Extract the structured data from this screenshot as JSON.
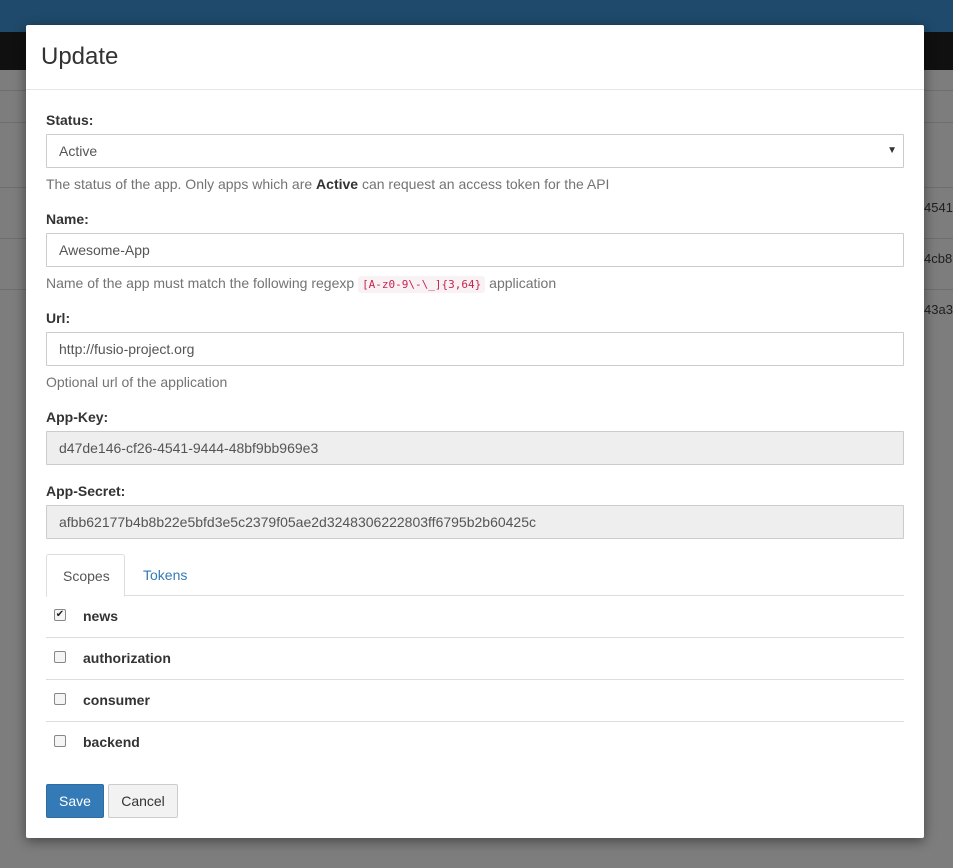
{
  "background": {
    "cells": [
      "4541-",
      "4cb8",
      "43a3"
    ]
  },
  "modal": {
    "title": "Update",
    "status": {
      "label": "Status:",
      "value": "Active",
      "help_prefix": "The status of the app. Only apps which are ",
      "help_bold": "Active",
      "help_suffix": " can request an access token for the API"
    },
    "name": {
      "label": "Name:",
      "value": "Awesome-App",
      "help_prefix": "Name of the app must match the following regexp ",
      "help_code": "[A-z0-9\\-\\_]{3,64}",
      "help_suffix": " application"
    },
    "url": {
      "label": "Url:",
      "value": "http://fusio-project.org",
      "help": "Optional url of the application"
    },
    "app_key": {
      "label": "App-Key:",
      "value": "d47de146-cf26-4541-9444-48bf9bb969e3"
    },
    "app_secret": {
      "label": "App-Secret:",
      "value": "afbb62177b4b8b22e5bfd3e5c2379f05ae2d3248306222803ff6795b2b60425c"
    },
    "tabs": [
      "Scopes",
      "Tokens"
    ],
    "scopes": [
      {
        "name": "news",
        "checked": true
      },
      {
        "name": "authorization",
        "checked": false
      },
      {
        "name": "consumer",
        "checked": false
      },
      {
        "name": "backend",
        "checked": false
      }
    ],
    "buttons": {
      "save": "Save",
      "cancel": "Cancel"
    }
  },
  "colors": {
    "primary": "#337ab7",
    "link": "#337ab7",
    "code": "#c7254e"
  }
}
